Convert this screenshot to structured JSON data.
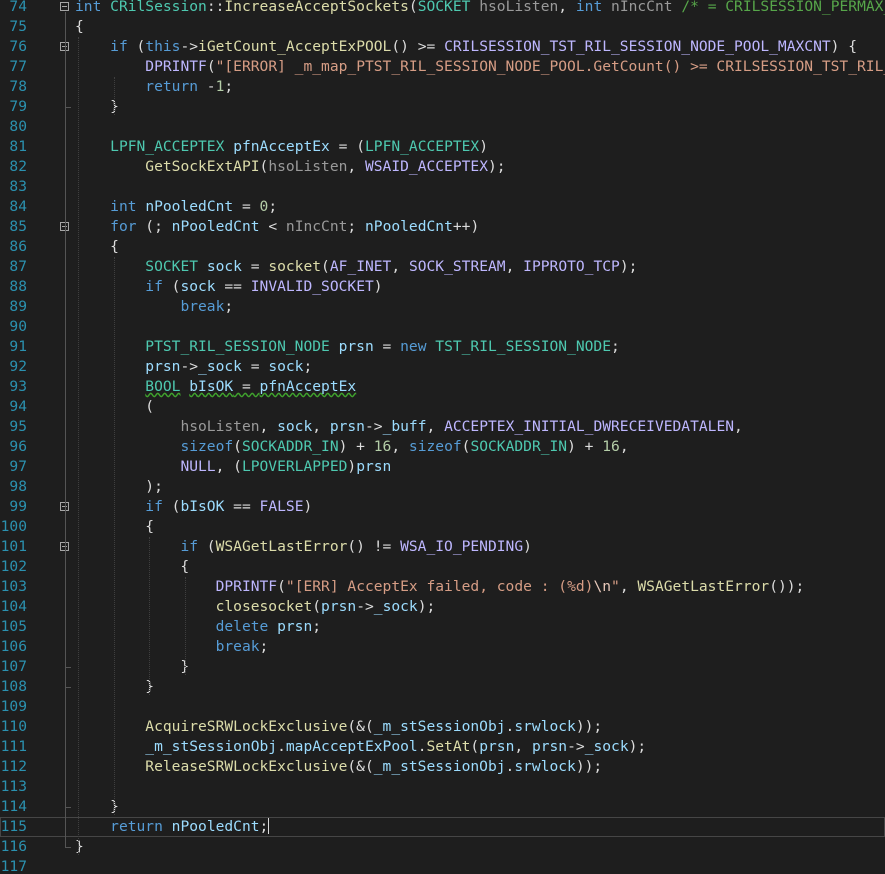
{
  "editor": {
    "first_line": 74,
    "current_line": 115,
    "lines": [
      {
        "n": "74",
        "fold": true,
        "t": [
          [
            "kw",
            "int"
          ],
          [
            "t",
            " "
          ],
          [
            "ty",
            "CRilSession"
          ],
          [
            "t",
            "::"
          ],
          [
            "fn",
            "IncreaseAcceptSockets"
          ],
          [
            "t",
            "("
          ],
          [
            "ty",
            "SOCKET"
          ],
          [
            "t",
            " "
          ],
          [
            "par",
            "hsoListen"
          ],
          [
            "t",
            ", "
          ],
          [
            "kw",
            "int"
          ],
          [
            "t",
            " "
          ],
          [
            "par",
            "nIncCnt"
          ],
          [
            "t",
            " "
          ],
          [
            "cmt",
            "/* = CRILSESSION_PERMAX_ACCEPT_CNT */"
          ],
          [
            "t",
            ")"
          ]
        ]
      },
      {
        "n": "75",
        "t": [
          [
            "t",
            "{"
          ]
        ]
      },
      {
        "n": "76",
        "fold": true,
        "t": [
          [
            "t",
            "    "
          ],
          [
            "kw",
            "if"
          ],
          [
            "t",
            " ("
          ],
          [
            "kw",
            "this"
          ],
          [
            "t",
            "->"
          ],
          [
            "fn",
            "iGetCount_AcceptExPOOL"
          ],
          [
            "t",
            "() >= "
          ],
          [
            "mac",
            "CRILSESSION_TST_RIL_SESSION_NODE_POOL_MAXCNT"
          ],
          [
            "t",
            ") {"
          ]
        ]
      },
      {
        "n": "77",
        "t": [
          [
            "t",
            "        "
          ],
          [
            "mac",
            "DPRINTF"
          ],
          [
            "t",
            "("
          ],
          [
            "str",
            "\"[ERROR] _m_map_PTST_RIL_SESSION_NODE_POOL.GetCount() >= CRILSESSION_TST_RIL_SESSION_NODE_POOL_MAXCNT\""
          ],
          [
            "t",
            ");"
          ]
        ]
      },
      {
        "n": "78",
        "t": [
          [
            "t",
            "        "
          ],
          [
            "kw",
            "return"
          ],
          [
            "t",
            " -"
          ],
          [
            "num",
            "1"
          ],
          [
            "t",
            ";"
          ]
        ]
      },
      {
        "n": "79",
        "t": [
          [
            "t",
            "    }"
          ]
        ]
      },
      {
        "n": "80",
        "t": []
      },
      {
        "n": "81",
        "t": [
          [
            "t",
            "    "
          ],
          [
            "ty",
            "LPFN_ACCEPTEX"
          ],
          [
            "t",
            " "
          ],
          [
            "loc",
            "pfnAcceptEx"
          ],
          [
            "t",
            " = ("
          ],
          [
            "ty",
            "LPFN_ACCEPTEX"
          ],
          [
            "t",
            ")"
          ]
        ]
      },
      {
        "n": "82",
        "t": [
          [
            "t",
            "        "
          ],
          [
            "fn",
            "GetSockExtAPI"
          ],
          [
            "t",
            "("
          ],
          [
            "par",
            "hsoListen"
          ],
          [
            "t",
            ", "
          ],
          [
            "mac",
            "WSAID_ACCEPTEX"
          ],
          [
            "t",
            ");"
          ]
        ]
      },
      {
        "n": "83",
        "t": []
      },
      {
        "n": "84",
        "t": [
          [
            "t",
            "    "
          ],
          [
            "kw",
            "int"
          ],
          [
            "t",
            " "
          ],
          [
            "loc",
            "nPooledCnt"
          ],
          [
            "t",
            " = "
          ],
          [
            "num",
            "0"
          ],
          [
            "t",
            ";"
          ]
        ]
      },
      {
        "n": "85",
        "fold": true,
        "t": [
          [
            "t",
            "    "
          ],
          [
            "kw",
            "for"
          ],
          [
            "t",
            " (; "
          ],
          [
            "loc",
            "nPooledCnt"
          ],
          [
            "t",
            " < "
          ],
          [
            "par",
            "nIncCnt"
          ],
          [
            "t",
            "; "
          ],
          [
            "loc",
            "nPooledCnt"
          ],
          [
            "t",
            "++)"
          ]
        ]
      },
      {
        "n": "86",
        "t": [
          [
            "t",
            "    {"
          ]
        ]
      },
      {
        "n": "87",
        "t": [
          [
            "t",
            "        "
          ],
          [
            "ty",
            "SOCKET"
          ],
          [
            "t",
            " "
          ],
          [
            "loc",
            "sock"
          ],
          [
            "t",
            " = "
          ],
          [
            "fn",
            "socket"
          ],
          [
            "t",
            "("
          ],
          [
            "mac",
            "AF_INET"
          ],
          [
            "t",
            ", "
          ],
          [
            "mac",
            "SOCK_STREAM"
          ],
          [
            "t",
            ", "
          ],
          [
            "mac",
            "IPPROTO_TCP"
          ],
          [
            "t",
            ");"
          ]
        ]
      },
      {
        "n": "88",
        "t": [
          [
            "t",
            "        "
          ],
          [
            "kw",
            "if"
          ],
          [
            "t",
            " ("
          ],
          [
            "loc",
            "sock"
          ],
          [
            "t",
            " == "
          ],
          [
            "mac",
            "INVALID_SOCKET"
          ],
          [
            "t",
            ")"
          ]
        ]
      },
      {
        "n": "89",
        "t": [
          [
            "t",
            "            "
          ],
          [
            "kw",
            "break"
          ],
          [
            "t",
            ";"
          ]
        ]
      },
      {
        "n": "90",
        "t": []
      },
      {
        "n": "91",
        "t": [
          [
            "t",
            "        "
          ],
          [
            "ty",
            "PTST_RIL_SESSION_NODE"
          ],
          [
            "t",
            " "
          ],
          [
            "loc",
            "prsn"
          ],
          [
            "t",
            " = "
          ],
          [
            "kw",
            "new"
          ],
          [
            "t",
            " "
          ],
          [
            "ty",
            "TST_RIL_SESSION_NODE"
          ],
          [
            "t",
            ";"
          ]
        ]
      },
      {
        "n": "92",
        "t": [
          [
            "t",
            "        "
          ],
          [
            "loc",
            "prsn"
          ],
          [
            "t",
            "->"
          ],
          [
            "loc",
            "_sock"
          ],
          [
            "t",
            " = "
          ],
          [
            "loc",
            "sock"
          ],
          [
            "t",
            ";"
          ]
        ]
      },
      {
        "n": "93",
        "t": [
          [
            "t",
            "        "
          ],
          [
            "ty",
            "BOOL",
            "sq"
          ],
          [
            "t",
            " "
          ],
          [
            "loc",
            "bIsOK",
            "sq"
          ],
          [
            "t",
            " = ",
            "sq"
          ],
          [
            "loc",
            "pfnAcceptEx",
            "sq"
          ]
        ]
      },
      {
        "n": "94",
        "t": [
          [
            "t",
            "        ("
          ]
        ]
      },
      {
        "n": "95",
        "t": [
          [
            "t",
            "            "
          ],
          [
            "par",
            "hsoListen"
          ],
          [
            "t",
            ", "
          ],
          [
            "loc",
            "sock"
          ],
          [
            "t",
            ", "
          ],
          [
            "loc",
            "prsn"
          ],
          [
            "t",
            "->"
          ],
          [
            "loc",
            "_buff"
          ],
          [
            "t",
            ", "
          ],
          [
            "mac",
            "ACCEPTEX_INITIAL_DWRECEIVEDATALEN"
          ],
          [
            "t",
            ","
          ]
        ]
      },
      {
        "n": "96",
        "t": [
          [
            "t",
            "            "
          ],
          [
            "kw",
            "sizeof"
          ],
          [
            "t",
            "("
          ],
          [
            "ty",
            "SOCKADDR_IN"
          ],
          [
            "t",
            ") + "
          ],
          [
            "num",
            "16"
          ],
          [
            "t",
            ", "
          ],
          [
            "kw",
            "sizeof"
          ],
          [
            "t",
            "("
          ],
          [
            "ty",
            "SOCKADDR_IN"
          ],
          [
            "t",
            ") + "
          ],
          [
            "num",
            "16"
          ],
          [
            "t",
            ","
          ]
        ]
      },
      {
        "n": "97",
        "t": [
          [
            "t",
            "            "
          ],
          [
            "mac",
            "NULL"
          ],
          [
            "t",
            ", ("
          ],
          [
            "ty",
            "LPOVERLAPPED"
          ],
          [
            "t",
            ")"
          ],
          [
            "loc",
            "prsn"
          ]
        ]
      },
      {
        "n": "98",
        "t": [
          [
            "t",
            "        );"
          ]
        ]
      },
      {
        "n": "99",
        "fold": true,
        "t": [
          [
            "t",
            "        "
          ],
          [
            "kw",
            "if"
          ],
          [
            "t",
            " ("
          ],
          [
            "loc",
            "bIsOK"
          ],
          [
            "t",
            " == "
          ],
          [
            "mac",
            "FALSE"
          ],
          [
            "t",
            ")"
          ]
        ]
      },
      {
        "n": "100",
        "t": [
          [
            "t",
            "        {"
          ]
        ]
      },
      {
        "n": "101",
        "fold": true,
        "t": [
          [
            "t",
            "            "
          ],
          [
            "kw",
            "if"
          ],
          [
            "t",
            " ("
          ],
          [
            "fn",
            "WSAGetLastError"
          ],
          [
            "t",
            "() != "
          ],
          [
            "mac",
            "WSA_IO_PENDING"
          ],
          [
            "t",
            ")"
          ]
        ]
      },
      {
        "n": "102",
        "t": [
          [
            "t",
            "            {"
          ]
        ]
      },
      {
        "n": "103",
        "t": [
          [
            "t",
            "                "
          ],
          [
            "mac",
            "DPRINTF"
          ],
          [
            "t",
            "("
          ],
          [
            "str",
            "\"[ERR] AcceptEx failed, code : (%d)"
          ],
          [
            "esc",
            "\\n"
          ],
          [
            "str",
            "\""
          ],
          [
            "t",
            ", "
          ],
          [
            "fn",
            "WSAGetLastError"
          ],
          [
            "t",
            "());"
          ]
        ]
      },
      {
        "n": "104",
        "t": [
          [
            "t",
            "                "
          ],
          [
            "fn",
            "closesocket"
          ],
          [
            "t",
            "("
          ],
          [
            "loc",
            "prsn"
          ],
          [
            "t",
            "->"
          ],
          [
            "loc",
            "_sock"
          ],
          [
            "t",
            ");"
          ]
        ]
      },
      {
        "n": "105",
        "t": [
          [
            "t",
            "                "
          ],
          [
            "kw",
            "delete"
          ],
          [
            "t",
            " "
          ],
          [
            "loc",
            "prsn"
          ],
          [
            "t",
            ";"
          ]
        ]
      },
      {
        "n": "106",
        "t": [
          [
            "t",
            "                "
          ],
          [
            "kw",
            "break"
          ],
          [
            "t",
            ";"
          ]
        ]
      },
      {
        "n": "107",
        "t": [
          [
            "t",
            "            }"
          ]
        ]
      },
      {
        "n": "108",
        "t": [
          [
            "t",
            "        }"
          ]
        ]
      },
      {
        "n": "109",
        "t": []
      },
      {
        "n": "110",
        "t": [
          [
            "t",
            "        "
          ],
          [
            "fn",
            "AcquireSRWLockExclusive"
          ],
          [
            "t",
            "(&("
          ],
          [
            "loc",
            "_m_stSessionObj"
          ],
          [
            "t",
            "."
          ],
          [
            "loc",
            "srwlock"
          ],
          [
            "t",
            "));"
          ]
        ]
      },
      {
        "n": "111",
        "t": [
          [
            "t",
            "        "
          ],
          [
            "loc",
            "_m_stSessionObj"
          ],
          [
            "t",
            "."
          ],
          [
            "loc",
            "mapAcceptExPool"
          ],
          [
            "t",
            "."
          ],
          [
            "fn",
            "SetAt"
          ],
          [
            "t",
            "("
          ],
          [
            "loc",
            "prsn"
          ],
          [
            "t",
            ", "
          ],
          [
            "loc",
            "prsn"
          ],
          [
            "t",
            "->"
          ],
          [
            "loc",
            "_sock"
          ],
          [
            "t",
            ");"
          ]
        ]
      },
      {
        "n": "112",
        "t": [
          [
            "t",
            "        "
          ],
          [
            "fn",
            "ReleaseSRWLockExclusive"
          ],
          [
            "t",
            "(&("
          ],
          [
            "loc",
            "_m_stSessionObj"
          ],
          [
            "t",
            "."
          ],
          [
            "loc",
            "srwlock"
          ],
          [
            "t",
            "));"
          ]
        ]
      },
      {
        "n": "113",
        "t": []
      },
      {
        "n": "114",
        "t": [
          [
            "t",
            "    }"
          ]
        ]
      },
      {
        "n": "115",
        "t": [
          [
            "t",
            "    "
          ],
          [
            "kw",
            "return"
          ],
          [
            "t",
            " "
          ],
          [
            "loc",
            "nPooledCnt"
          ],
          [
            "t",
            ";"
          ]
        ]
      },
      {
        "n": "116",
        "t": [
          [
            "t",
            "}"
          ]
        ]
      },
      {
        "n": "117",
        "t": []
      }
    ]
  }
}
